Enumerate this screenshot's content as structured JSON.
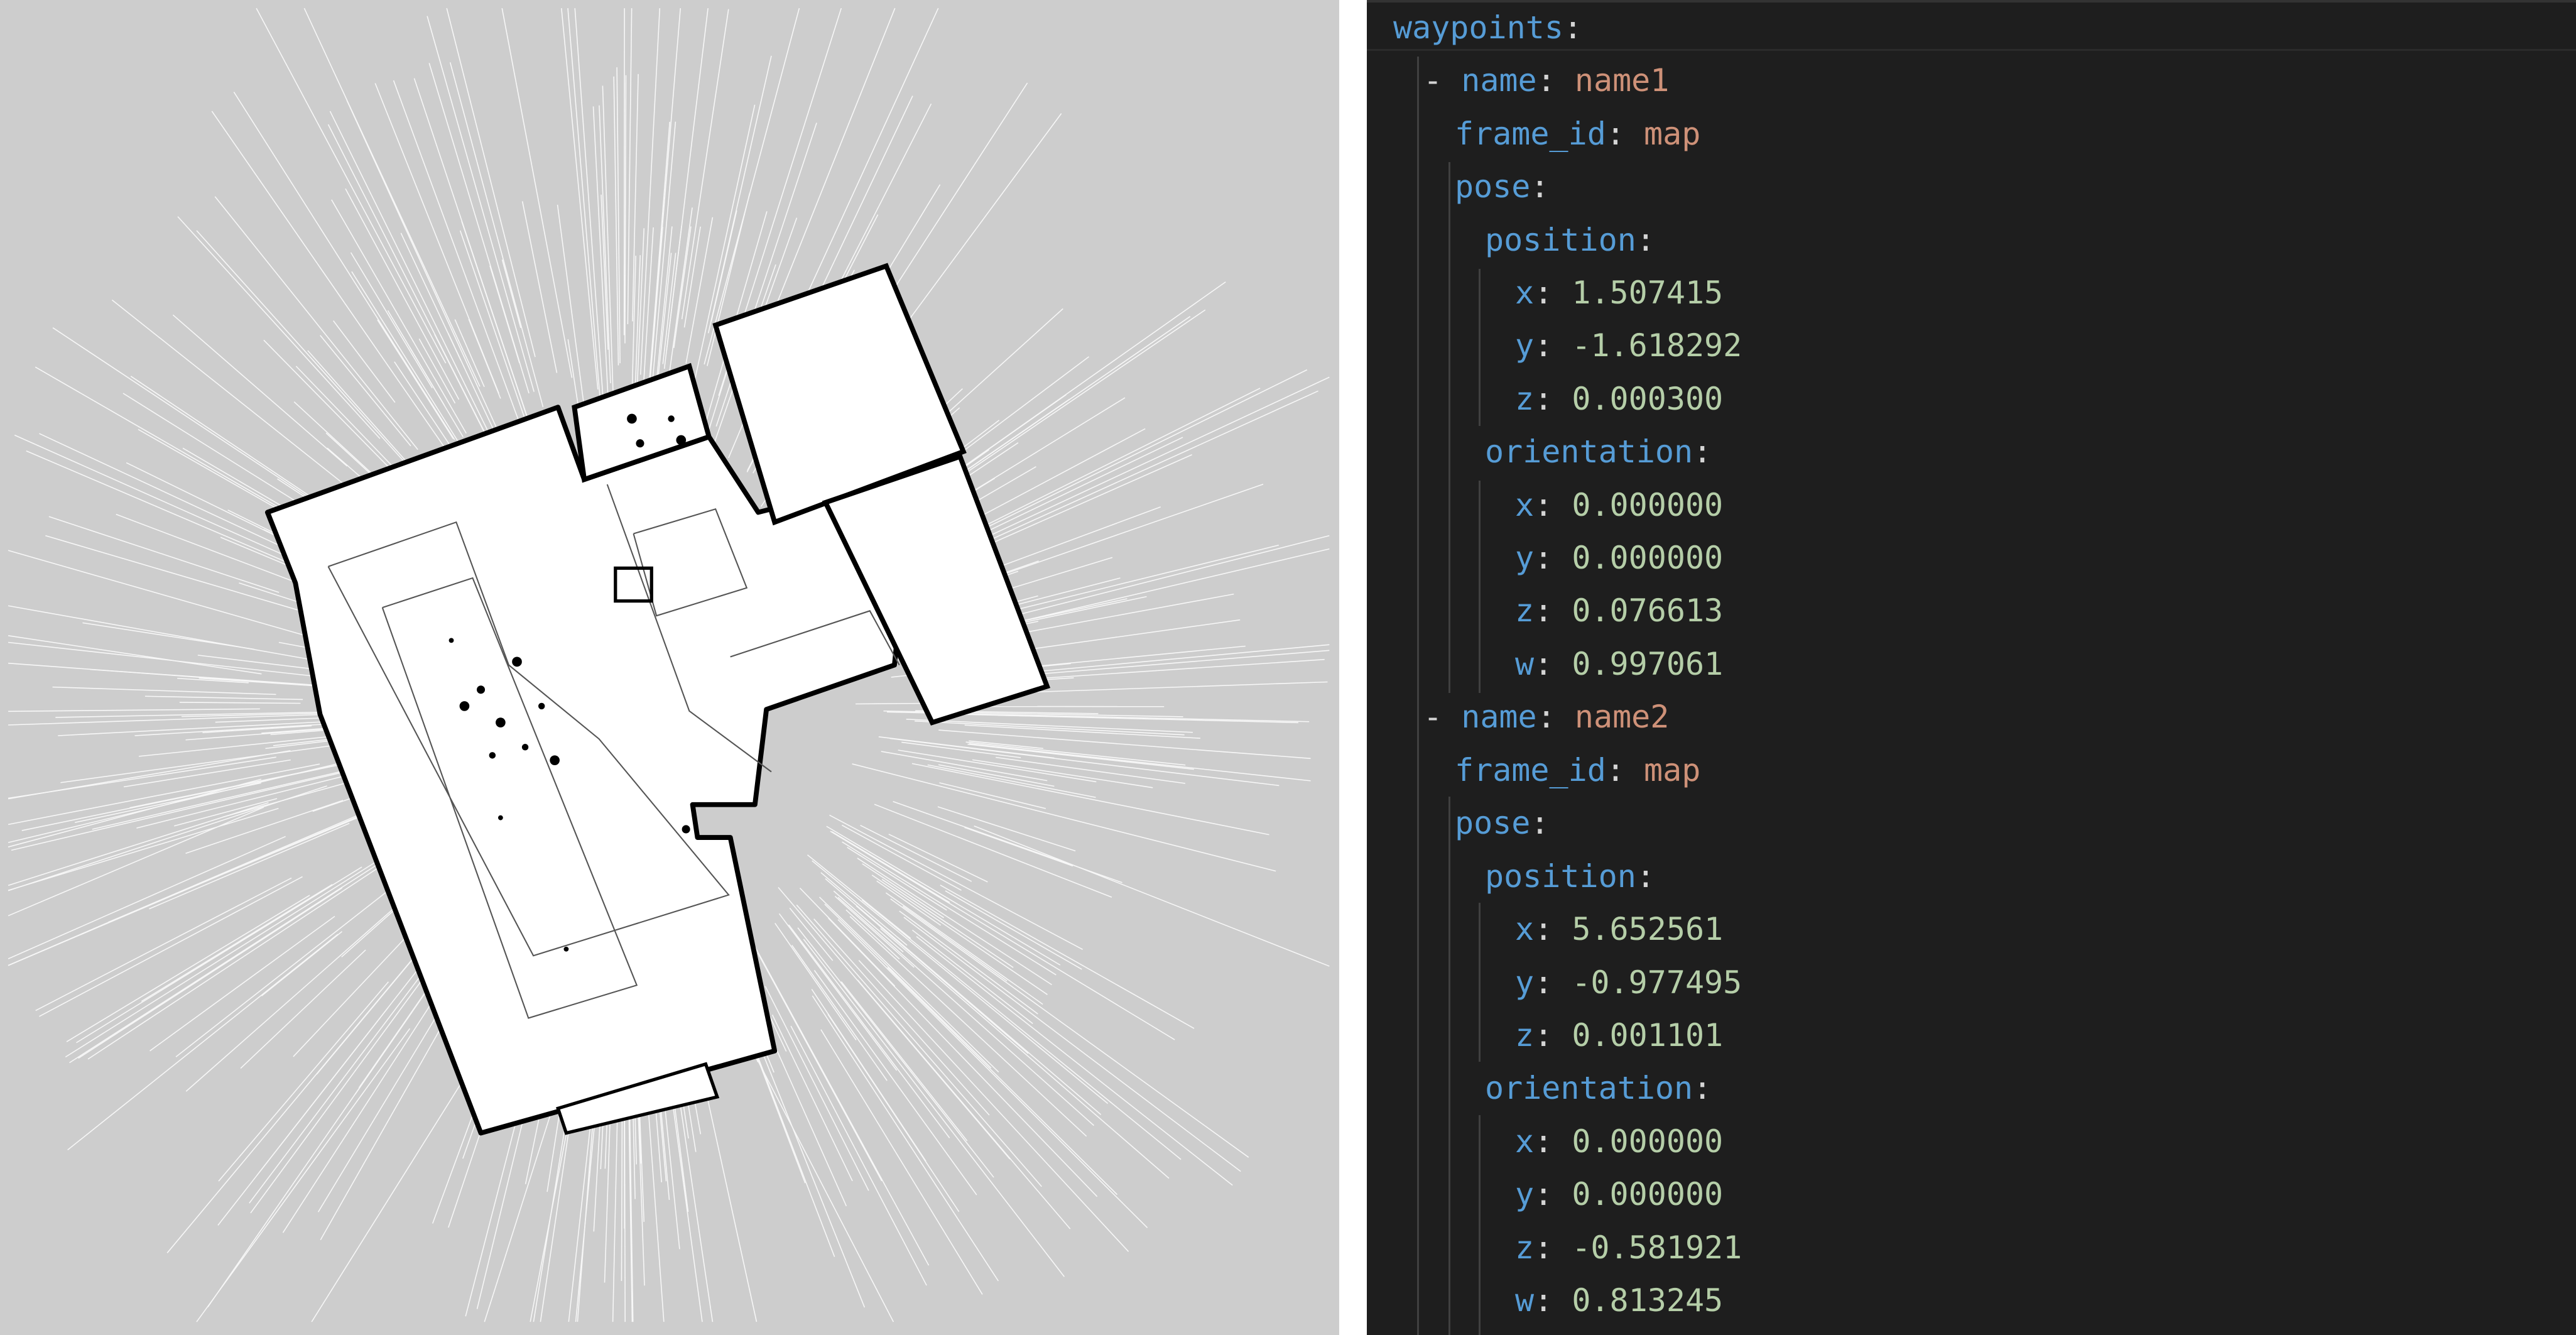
{
  "colors": {
    "map_background": "#cdcdcd",
    "map_free_space": "#ffffff",
    "map_obstacle": "#000000",
    "editor_background": "#1e1e1e",
    "yaml_key": "#569cd6",
    "yaml_string": "#ce9178",
    "yaml_number": "#b5cea8"
  },
  "map_view": {
    "description_icon": "occupancy-grid-map"
  },
  "editor": {
    "root_key": "waypoints",
    "waypoints": [
      {
        "name": "name1",
        "frame_id": "map",
        "position": {
          "x": "1.507415",
          "y": "-1.618292",
          "z": "0.000300"
        },
        "orientation": {
          "x": "0.000000",
          "y": "0.000000",
          "z": "0.076613",
          "w": "0.997061"
        }
      },
      {
        "name": "name2",
        "frame_id": "map",
        "position": {
          "x": "5.652561",
          "y": "-0.977495",
          "z": "0.001101"
        },
        "orientation": {
          "x": "0.000000",
          "y": "0.000000",
          "z": "-0.581921",
          "w": "0.813245"
        }
      }
    ],
    "keys": {
      "name": "name",
      "frame_id": "frame_id",
      "pose": "pose",
      "position": "position",
      "orientation": "orientation",
      "x": "x",
      "y": "y",
      "z": "z",
      "w": "w"
    }
  }
}
